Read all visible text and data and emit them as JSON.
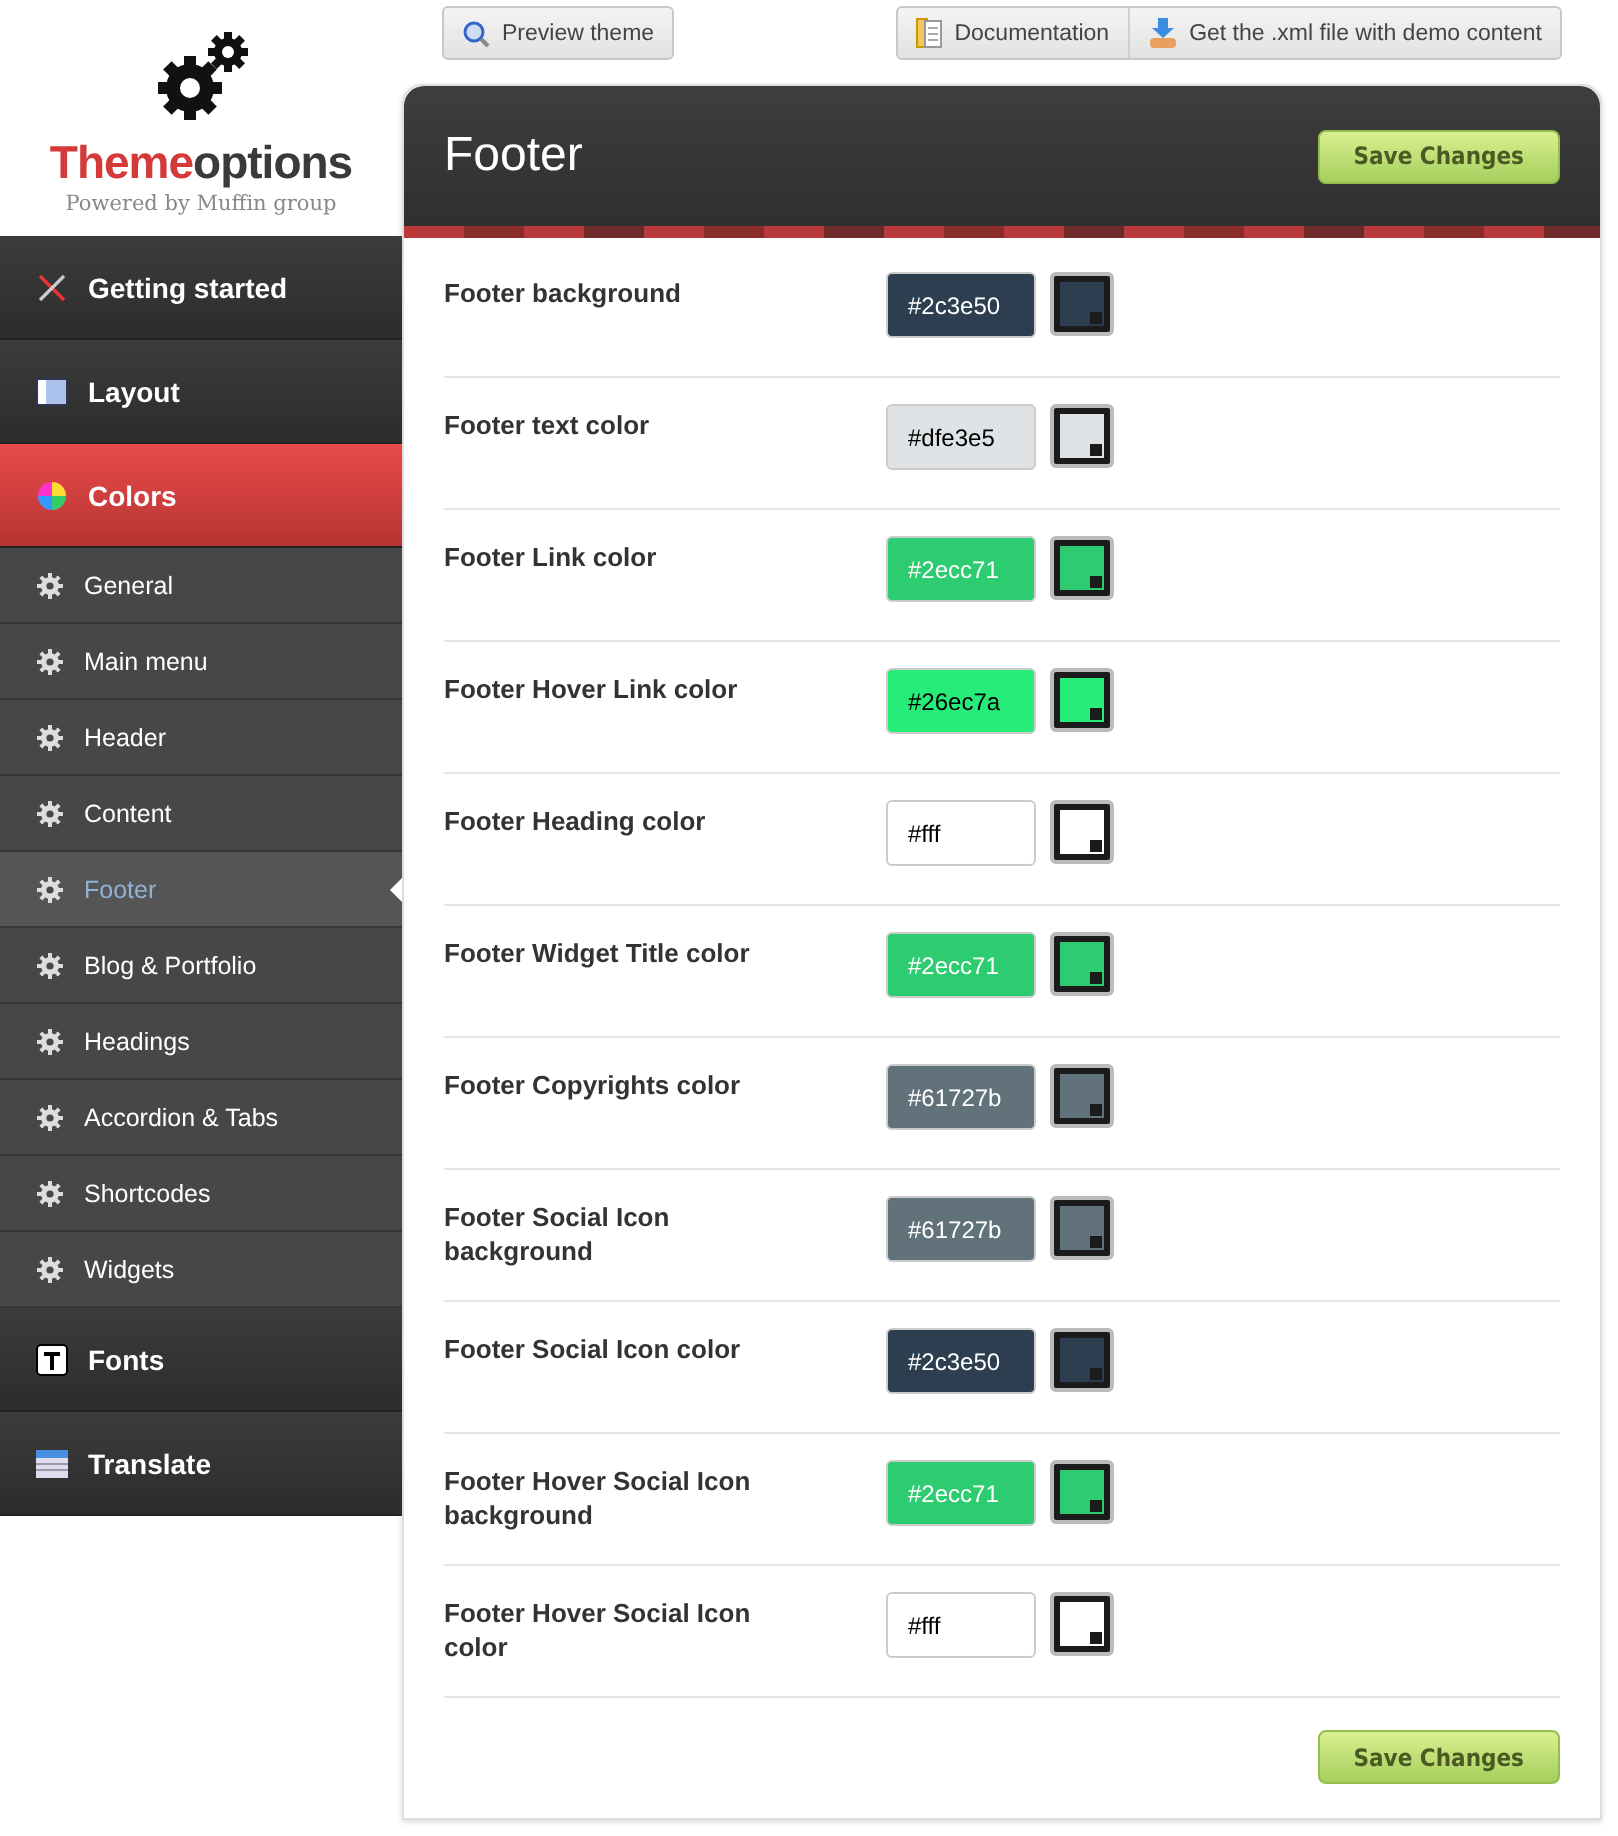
{
  "logo": {
    "brand_first": "Theme",
    "brand_second": "options",
    "tagline": "Powered by Muffin group"
  },
  "toolbar": {
    "left": [
      {
        "label": "Preview theme"
      }
    ],
    "right": [
      {
        "label": "Documentation"
      },
      {
        "label": "Get the .xml file with demo content"
      }
    ]
  },
  "sidebar": {
    "items": [
      {
        "kind": "section",
        "label": "Getting started",
        "selected": false
      },
      {
        "kind": "section",
        "label": "Layout",
        "selected": false
      },
      {
        "kind": "section",
        "label": "Colors",
        "selected": true
      },
      {
        "kind": "sub",
        "label": "General",
        "selected": false
      },
      {
        "kind": "sub",
        "label": "Main menu",
        "selected": false
      },
      {
        "kind": "sub",
        "label": "Header",
        "selected": false
      },
      {
        "kind": "sub",
        "label": "Content",
        "selected": false
      },
      {
        "kind": "sub",
        "label": "Footer",
        "selected": true
      },
      {
        "kind": "sub",
        "label": "Blog & Portfolio",
        "selected": false
      },
      {
        "kind": "sub",
        "label": "Headings",
        "selected": false
      },
      {
        "kind": "sub",
        "label": "Accordion & Tabs",
        "selected": false
      },
      {
        "kind": "sub",
        "label": "Shortcodes",
        "selected": false
      },
      {
        "kind": "sub",
        "label": "Widgets",
        "selected": false
      },
      {
        "kind": "section",
        "label": "Fonts",
        "selected": false
      },
      {
        "kind": "section",
        "label": "Translate",
        "selected": false
      }
    ]
  },
  "panel": {
    "title": "Footer",
    "save_button": "Save Changes",
    "bottom_save_button": "Save Changes",
    "options": [
      {
        "label": "Footer background",
        "value": "#2c3e50",
        "color": "#2c3e50"
      },
      {
        "label": "Footer text color",
        "value": "#dfe3e5",
        "color": "#dfe3e5"
      },
      {
        "label": "Footer Link color",
        "value": "#2ecc71",
        "color": "#2ecc71"
      },
      {
        "label": "Footer Hover Link color",
        "value": "#26ec7a",
        "color": "#26ec7a"
      },
      {
        "label": "Footer Heading color",
        "value": "#fff",
        "color": "#ffffff"
      },
      {
        "label": "Footer Widget Title color",
        "value": "#2ecc71",
        "color": "#2ecc71"
      },
      {
        "label": "Footer Copyrights color",
        "value": "#61727b",
        "color": "#61727b"
      },
      {
        "label": "Footer Social Icon background",
        "value": "#61727b",
        "color": "#61727b"
      },
      {
        "label": "Footer Social Icon color",
        "value": "#2c3e50",
        "color": "#2c3e50"
      },
      {
        "label": "Footer Hover Social Icon background",
        "value": "#2ecc71",
        "color": "#2ecc71"
      },
      {
        "label": "Footer Hover Social Icon color",
        "value": "#fff",
        "color": "#ffffff"
      }
    ]
  }
}
